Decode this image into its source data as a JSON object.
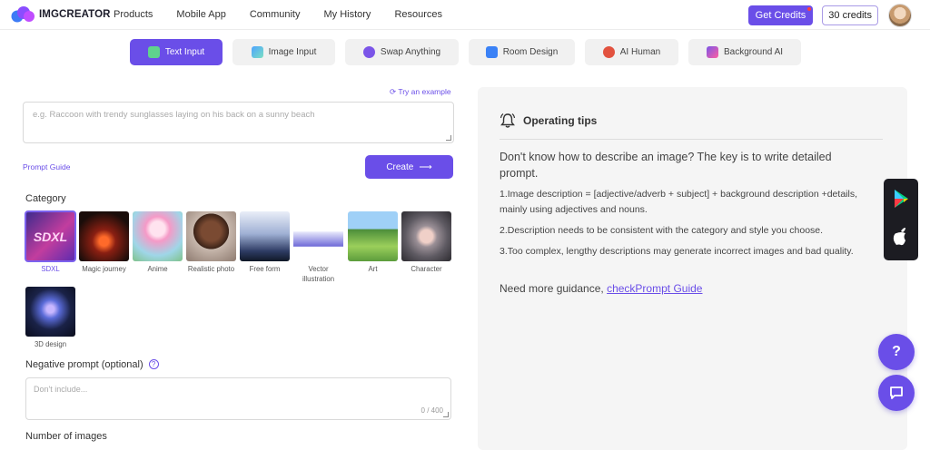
{
  "nav": {
    "brand": "IMGCREATOR",
    "links": [
      "Products",
      "Mobile App",
      "Community",
      "My History",
      "Resources"
    ],
    "get_credits": "Get Credits",
    "credits": "30 credits"
  },
  "tabs": [
    {
      "label": "Text Input",
      "icon": "text-icon",
      "active": true
    },
    {
      "label": "Image Input",
      "icon": "image-icon",
      "active": false
    },
    {
      "label": "Swap Anything",
      "icon": "swap-icon",
      "active": false
    },
    {
      "label": "Room Design",
      "icon": "room-icon",
      "active": false
    },
    {
      "label": "AI Human",
      "icon": "human-icon",
      "active": false
    },
    {
      "label": "Background AI",
      "icon": "background-icon",
      "active": false
    }
  ],
  "prompt": {
    "try_example": "Try an example",
    "placeholder": "e.g. Raccoon with trendy sunglasses laying on his back on a sunny beach",
    "guide_link": "Prompt Guide",
    "create_label": "Create"
  },
  "category": {
    "label": "Category",
    "items": [
      {
        "name": "SDXL",
        "selected": true
      },
      {
        "name": "Magic journey",
        "selected": false
      },
      {
        "name": "Anime",
        "selected": false
      },
      {
        "name": "Realistic photo",
        "selected": false
      },
      {
        "name": "Free form",
        "selected": false
      },
      {
        "name": "Vector illustration",
        "selected": false
      },
      {
        "name": "Art",
        "selected": false
      },
      {
        "name": "Character",
        "selected": false
      },
      {
        "name": "3D design",
        "selected": false
      }
    ]
  },
  "negative": {
    "label": "Negative prompt (optional)",
    "placeholder": "Don't include...",
    "count": "0 / 400"
  },
  "number_images_label": "Number of images",
  "tips": {
    "title": "Operating tips",
    "intro": "Don't know how to describe an image? The key is to write detailed prompt.",
    "tip1": "1.Image description = [adjective/adverb + subject] + background description +details, mainly using adjectives and nouns.",
    "tip2": "2.Description needs to be consistent with the category and style you choose.",
    "tip3": "3.Too complex, lengthy descriptions may generate incorrect images and bad quality.",
    "more": "Need more guidance, ",
    "more_link": "checkPrompt Guide"
  },
  "colors": {
    "accent": "#6a4ee8",
    "panel": "#f5f5f5"
  }
}
